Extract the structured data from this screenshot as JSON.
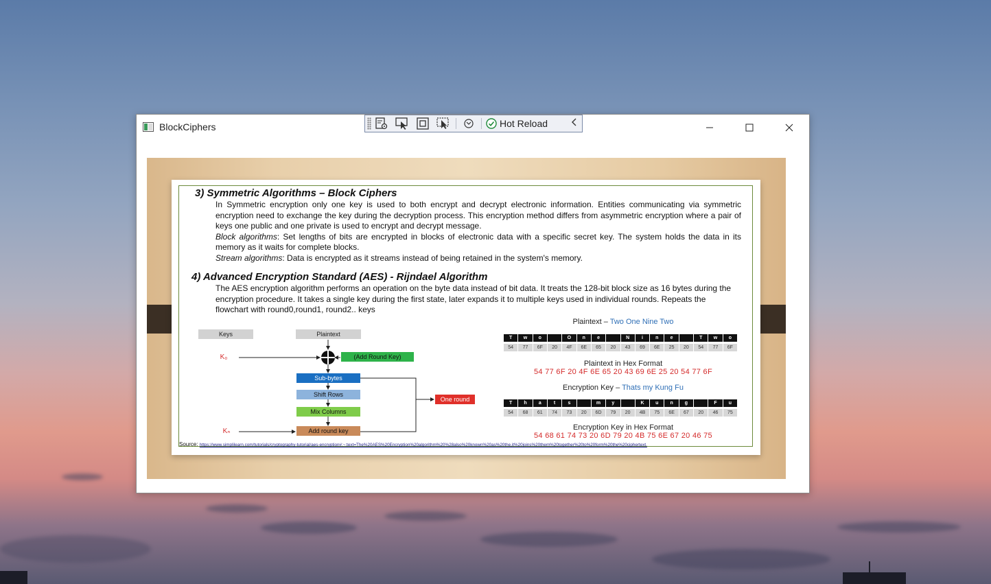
{
  "window": {
    "title": "BlockCiphers"
  },
  "devtools": {
    "hot_reload_label": "Hot Reload"
  },
  "slide": {
    "section3": {
      "heading": "3) Symmetric Algorithms – Block Ciphers",
      "line1": "In Symmetric encryption only one key is used to both encrypt and decrypt electronic information. Entities communicating via symmetric encryption need to exchange the key during the decryption process. This encryption method differs from asymmetric encryption where a pair of keys one public and one private is used to encrypt and decrypt message.",
      "block_term": "Block algorithms",
      "block_text": ": Set lengths of bits are encrypted in blocks of electronic data with a specific secret key. The system holds the data in its memory as it waits for complete blocks.",
      "stream_term": "Stream algorithms",
      "stream_text": ": Data is encrypted as it streams instead of being retained in the system's memory."
    },
    "section4": {
      "heading": "4) Advanced Encryption Standard (AES) - Rijndael Algorithm",
      "text": "The AES encryption algorithm performs an operation on the byte data instead of bit data.  It treats the 128-bit block size as 16 bytes during the encryption procedure. It takes a single key during the first state, later expands it to multiple keys used in individual rounds. Repeats the flowchart with round0,round1, round2.. keys"
    },
    "flowchart": {
      "keys_label": "Keys",
      "plaintext_label": "Plaintext",
      "k0": "K₀",
      "kn": "Kₙ",
      "add_round_key_top": "(Add Round Key)",
      "sub_bytes": "Sub-bytes",
      "shift_rows": "Shift Rows",
      "mix_columns": "Mix Columns",
      "add_round_key_bottom": "Add round key",
      "one_round": "One round"
    },
    "hex_panel": {
      "plaintext_title": "Plaintext –",
      "plaintext_value": "Two One Nine Two",
      "plaintext_chars": [
        "T",
        "w",
        "o",
        "",
        "O",
        "n",
        "e",
        "",
        "N",
        "i",
        "n",
        "e",
        "",
        "T",
        "w",
        "o"
      ],
      "plaintext_hex": [
        "54",
        "77",
        "6F",
        "20",
        "4F",
        "6E",
        "65",
        "20",
        "43",
        "69",
        "6E",
        "25",
        "20",
        "54",
        "77",
        "6F"
      ],
      "plaintext_hex_title": "Plaintext in Hex Format",
      "plaintext_hex_line": "54 77 6F 20 4F 6E 65 20 43 69 6E 25 20 54 77 6F",
      "key_title": "Encryption Key –",
      "key_value": "Thats my Kung Fu",
      "key_chars": [
        "T",
        "h",
        "a",
        "t",
        "s",
        "",
        "m",
        "y",
        "",
        "K",
        "u",
        "n",
        "g",
        "",
        "F",
        "u"
      ],
      "key_hex": [
        "54",
        "68",
        "61",
        "74",
        "73",
        "20",
        "6D",
        "79",
        "20",
        "4B",
        "75",
        "6E",
        "67",
        "20",
        "46",
        "75"
      ],
      "key_hex_title": "Encryption Key in Hex Format",
      "key_hex_line": "54 68 61 74 73 20 6D 79 20 4B 75 6E 67 20 46 75"
    },
    "source_label": "Source:",
    "source_url": "https://www.simplilearn.com/tutorials/cryptography-tutorial/aes-encryption#:~:text=The%20AES%20Encryption%20algorithm%20%28also%20known%20as%20the,it%20joins%20them%20together%20to%20form%20the%20ciphertext."
  }
}
